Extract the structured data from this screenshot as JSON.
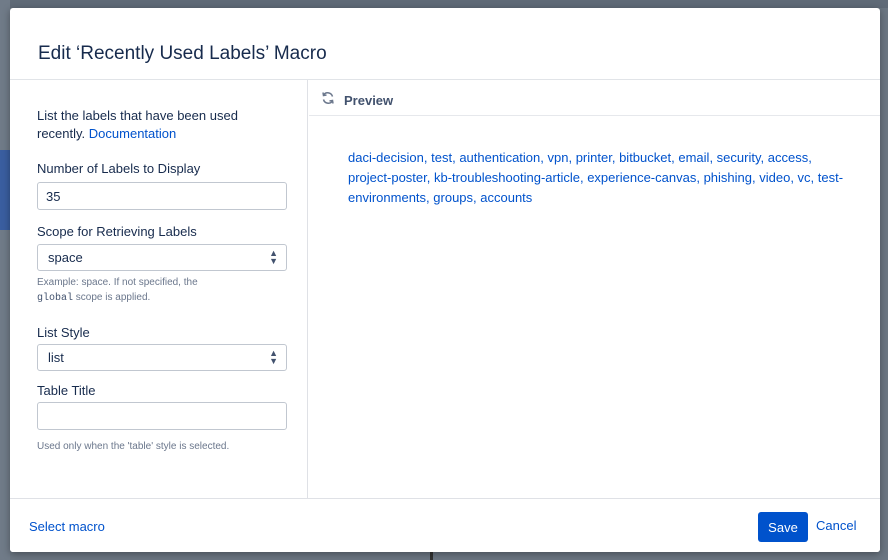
{
  "dialog": {
    "title": "Edit ‘Recently Used Labels’ Macro"
  },
  "form": {
    "intro_text": "List the labels that have been used recently.",
    "documentation_link": "Documentation",
    "num_labels": {
      "label": "Number of Labels to Display",
      "value": "35"
    },
    "scope": {
      "label": "Scope for Retrieving Labels",
      "value": "space",
      "help_prefix": "Example: space. If not specified, the",
      "help_code": "global",
      "help_suffix": "scope is applied."
    },
    "list_style": {
      "label": "List Style",
      "value": "list"
    },
    "table_title": {
      "label": "Table Title",
      "value": "",
      "help": "Used only when the 'table' style is selected."
    }
  },
  "preview": {
    "heading": "Preview",
    "labels": [
      "daci-decision",
      "test",
      "authentication",
      "vpn",
      "printer",
      "bitbucket",
      "email",
      "security",
      "access",
      "project-poster",
      "kb-troubleshooting-article",
      "experience-canvas",
      "phishing",
      "video",
      "vc",
      "test-environments",
      "groups",
      "accounts"
    ]
  },
  "footer": {
    "select_macro": "Select macro",
    "save": "Save",
    "cancel": "Cancel"
  },
  "colors": {
    "primary": "#0052cc",
    "text": "#172b4d",
    "muted": "#6b778c"
  }
}
